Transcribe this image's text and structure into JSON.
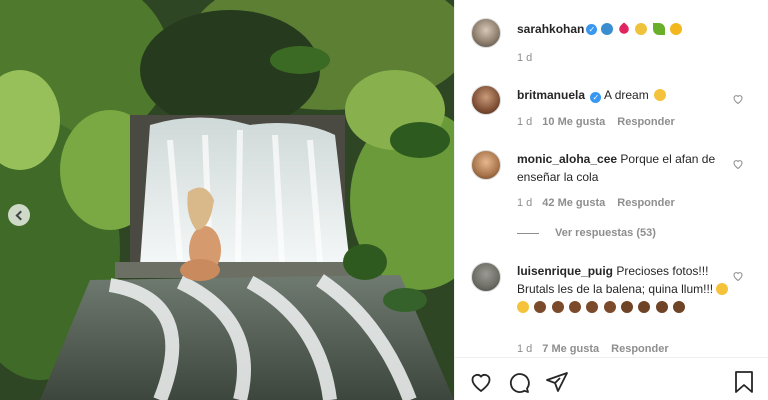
{
  "post": {
    "author": "sarahkohan",
    "caption_emojis": [
      "globe",
      "heart",
      "praying-hands",
      "leaf",
      "sun"
    ],
    "time": "1 d"
  },
  "comments": [
    {
      "username": "britmanuela",
      "verified": true,
      "text": "A dream",
      "time": "1 d",
      "likes": "10 Me gusta",
      "reply": "Responder"
    },
    {
      "username": "monic_aloha_cee",
      "verified": false,
      "text": "Porque el afan de enseñar la cola",
      "time": "1 d",
      "likes": "42 Me gusta",
      "reply": "Responder",
      "view_replies": "Ver respuestas (53)"
    },
    {
      "username": "luisenrique_puig",
      "verified": false,
      "text": "Precioses fotos!!! Brutals les de la balena; quina llum!!!",
      "time": "1 d",
      "likes": "7 Me gusta",
      "reply": "Responder"
    }
  ],
  "colors": {
    "verified": "#3897f0",
    "meta": "#8e8e8e",
    "text": "#262626"
  }
}
